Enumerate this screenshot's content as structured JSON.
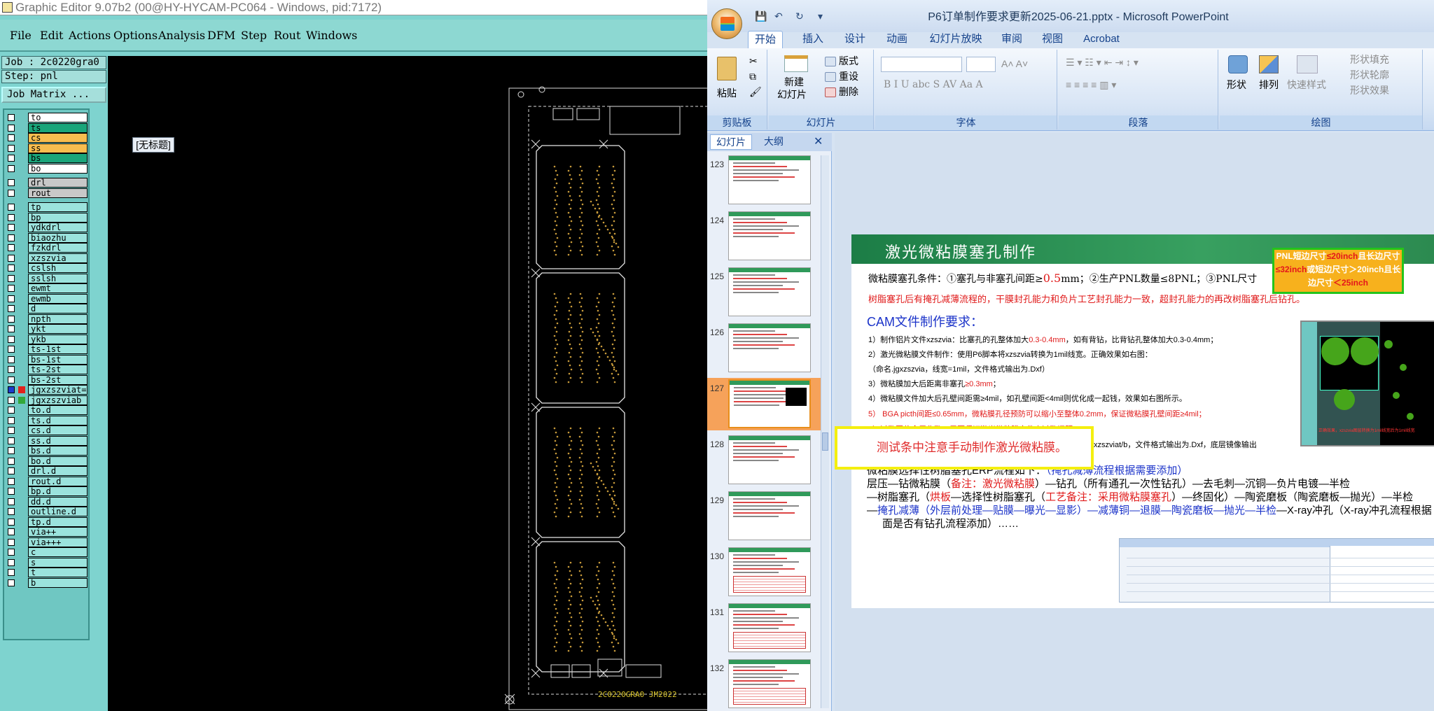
{
  "graphic_editor": {
    "title": "Graphic Editor 9.07b2 (00@HY-HYCAM-PC064 - Windows, pid:7172)",
    "menu": [
      "File",
      "Edit",
      "Actions",
      "Options",
      "Analysis",
      "DFM",
      "Step",
      "Rout",
      "Windows"
    ],
    "job": "Job : 2c0220gra0",
    "step": "Step: pnl",
    "job_matrix": "Job Matrix ...",
    "untitled_popup": "[无标题]",
    "board_text": "2C0220GRA0 JM2022",
    "layers": [
      {
        "name": "to",
        "color": "#ffffff",
        "group": 1
      },
      {
        "name": "ts",
        "color": "#1aa57a",
        "group": 1
      },
      {
        "name": "cs",
        "color": "#f7bd4f",
        "group": 1
      },
      {
        "name": "ss",
        "color": "#f7bd4f",
        "group": 1
      },
      {
        "name": "bs",
        "color": "#1aa57a",
        "group": 1
      },
      {
        "name": "bo",
        "color": "#ffffff",
        "group": 1
      },
      {
        "name": "drl",
        "color": "#c8c8c8",
        "group": 2
      },
      {
        "name": "rout",
        "color": "#c8c8c8",
        "group": 2
      },
      {
        "name": "tp",
        "color": "#9be3dd",
        "group": 3
      },
      {
        "name": "bp",
        "color": "#9be3dd",
        "group": 3
      },
      {
        "name": "ydkdrl",
        "color": "#9be3dd",
        "group": 3
      },
      {
        "name": "biaozhu",
        "color": "#9be3dd",
        "group": 3
      },
      {
        "name": "fzkdrl",
        "color": "#9be3dd",
        "group": 3
      },
      {
        "name": "xzszvia",
        "color": "#9be3dd",
        "group": 3
      },
      {
        "name": "cslsh",
        "color": "#9be3dd",
        "group": 3
      },
      {
        "name": "sslsh",
        "color": "#9be3dd",
        "group": 3
      },
      {
        "name": "ewmt",
        "color": "#9be3dd",
        "group": 3
      },
      {
        "name": "ewmb",
        "color": "#9be3dd",
        "group": 3
      },
      {
        "name": "d",
        "color": "#9be3dd",
        "group": 3
      },
      {
        "name": "npth",
        "color": "#9be3dd",
        "group": 3
      },
      {
        "name": "ykt",
        "color": "#9be3dd",
        "group": 3
      },
      {
        "name": "ykb",
        "color": "#9be3dd",
        "group": 3
      },
      {
        "name": "ts-1st",
        "color": "#9be3dd",
        "group": 3
      },
      {
        "name": "bs-1st",
        "color": "#9be3dd",
        "group": 3
      },
      {
        "name": "ts-2st",
        "color": "#9be3dd",
        "group": 3
      },
      {
        "name": "bs-2st",
        "color": "#9be3dd",
        "group": 3
      },
      {
        "name": "jgxzszviat=",
        "color": "#9be3dd",
        "group": 3,
        "marker": "#e2211c",
        "selected": true
      },
      {
        "name": "jgxzszviab",
        "color": "#9be3dd",
        "group": 3,
        "marker": "#33a83a"
      },
      {
        "name": "to.d",
        "color": "#9be3dd",
        "group": 3
      },
      {
        "name": "ts.d",
        "color": "#9be3dd",
        "group": 3
      },
      {
        "name": "cs.d",
        "color": "#9be3dd",
        "group": 3
      },
      {
        "name": "ss.d",
        "color": "#9be3dd",
        "group": 3
      },
      {
        "name": "bs.d",
        "color": "#9be3dd",
        "group": 3
      },
      {
        "name": "bo.d",
        "color": "#9be3dd",
        "group": 3
      },
      {
        "name": "drl.d",
        "color": "#9be3dd",
        "group": 3
      },
      {
        "name": "rout.d",
        "color": "#9be3dd",
        "group": 3
      },
      {
        "name": "bp.d",
        "color": "#9be3dd",
        "group": 3
      },
      {
        "name": "dd.d",
        "color": "#9be3dd",
        "group": 3
      },
      {
        "name": "outline.d",
        "color": "#9be3dd",
        "group": 3
      },
      {
        "name": "tp.d",
        "color": "#9be3dd",
        "group": 3
      },
      {
        "name": "via++",
        "color": "#9be3dd",
        "group": 3
      },
      {
        "name": "via+++",
        "color": "#9be3dd",
        "group": 3
      },
      {
        "name": "c",
        "color": "#9be3dd",
        "group": 3
      },
      {
        "name": "s",
        "color": "#9be3dd",
        "group": 3
      },
      {
        "name": "t",
        "color": "#9be3dd",
        "group": 3
      },
      {
        "name": "b",
        "color": "#9be3dd",
        "group": 3
      }
    ]
  },
  "powerpoint": {
    "title": "P6订单制作要求更新2025-06-21.pptx - Microsoft PowerPoint",
    "tabs": [
      "开始",
      "插入",
      "设计",
      "动画",
      "幻灯片放映",
      "审阅",
      "视图",
      "Acrobat"
    ],
    "active_tab": "开始",
    "ribbon": {
      "clipboard": {
        "label": "剪贴板",
        "paste": "粘贴"
      },
      "slides": {
        "label": "幻灯片",
        "new_slide": "新建",
        "new_slide2": "幻灯片",
        "layout": "版式",
        "reset": "重设",
        "delete": "删除"
      },
      "font": {
        "label": "字体"
      },
      "paragraph": {
        "label": "段落"
      },
      "drawing": {
        "label": "绘图",
        "shape": "形状",
        "arrange": "排列",
        "quick_styles": "快速样式",
        "fill": "形状填充",
        "outline": "形状轮廓",
        "effects": "形状效果"
      }
    },
    "pane_tabs": [
      "幻灯片",
      "大纲"
    ],
    "thumbnails": [
      123,
      124,
      125,
      126,
      127,
      128,
      129,
      130,
      131,
      132
    ],
    "selected_slide": 127,
    "slide": {
      "title": "激光微粘膜塞孔制作",
      "pnl_box": [
        "PNL短边尺寸",
        "≤20inch",
        "且长边尺寸",
        "≤32inch",
        "或短边尺寸＞20inch且长",
        "边尺寸",
        "＜25inch"
      ],
      "cond1": "微粘膜塞孔条件：①塞孔与非塞孔间距≥",
      "cond1_val": "0.5",
      "cond1_b": "mm；②生产PNL数量≤8PNL；③PNL尺寸",
      "cond2": "树脂塞孔后有掩孔减薄流程的，干膜封孔能力和负片工艺封孔能力一致，超封孔能力的再改树脂塞孔后钻孔。",
      "cam_heading": "CAM文件制作要求：",
      "req1": "1）制作铝片文件xzszvia：比塞孔的孔整体加大",
      "req1r": "0.3-0.4mm",
      "req1b": "，如有背钻，比背钻孔整体加大0.3-0.4mm；",
      "req2": "2）激光微粘膜文件制作：使用P6脚本将xzszvia转换为1mil线宽。正确效果如右图：",
      "req2b": "（命名.jgxzszvia，线宽=1mil，文件格式输出为.Dxf）",
      "req3": "3）微粘膜加大后距离非塞孔",
      "req3r": "≥0.3mm",
      "req3b": "；",
      "req4": "4）微粘膜文件加大后孔壁间距需≥4mil，如孔壁间距<4mil则优化成一起钱，效果如右图所示。",
      "req5": "5） BGA picth间距≤0.65mm，微粘膜孔径预防可以缩小至整体0.2mm，保证微粘膜孔壁间距≥4mil；",
      "req6": "6）过孔围住金属化孔，需要保证激光微粘膜文件内过孔间距≥4mil.",
      "req7": "7）激光微粘膜由出一张改为出两张(一张正面，一张反面)，命名.jgxzszviat/b，文件格式输出为.Dxf，底层镜像输出",
      "erp1": "微粘膜选择性树脂塞孔ERP流程如下：",
      "erp1b": "（掩孔减薄流程根据需要添加）",
      "erp2a": "层压—钻微粘膜（",
      "erp2b": "备注：激光微粘膜",
      "erp2c": "）—钻孔（所有通孔一次性钻孔）—去毛刺—沉铜—负片电镀—半检",
      "erp3a": "—树脂塞孔（",
      "erp3b": "烘板",
      "erp3c": "—选择性树脂塞孔（",
      "erp3d": "工艺备注：采用微粘膜塞孔",
      "erp3e": "）—终固化）—陶瓷磨板（陶瓷磨板—抛光）—半检",
      "erp4a": "—",
      "erp4b": "掩孔减薄（外层前处理—贴膜—曝光—显影）—减薄铜—退膜—陶瓷磨板—抛光—半检",
      "erp4c": "—X-ray冲孔（X-ray冲孔流程根据",
      "erp5": "面是否有钻孔流程添加）……",
      "note": "测试条中注意手动制作激光微粘膜。",
      "cam_caption": "正确效果，xzszvia图层转换为1mil线宽后为1mil线宽"
    }
  }
}
